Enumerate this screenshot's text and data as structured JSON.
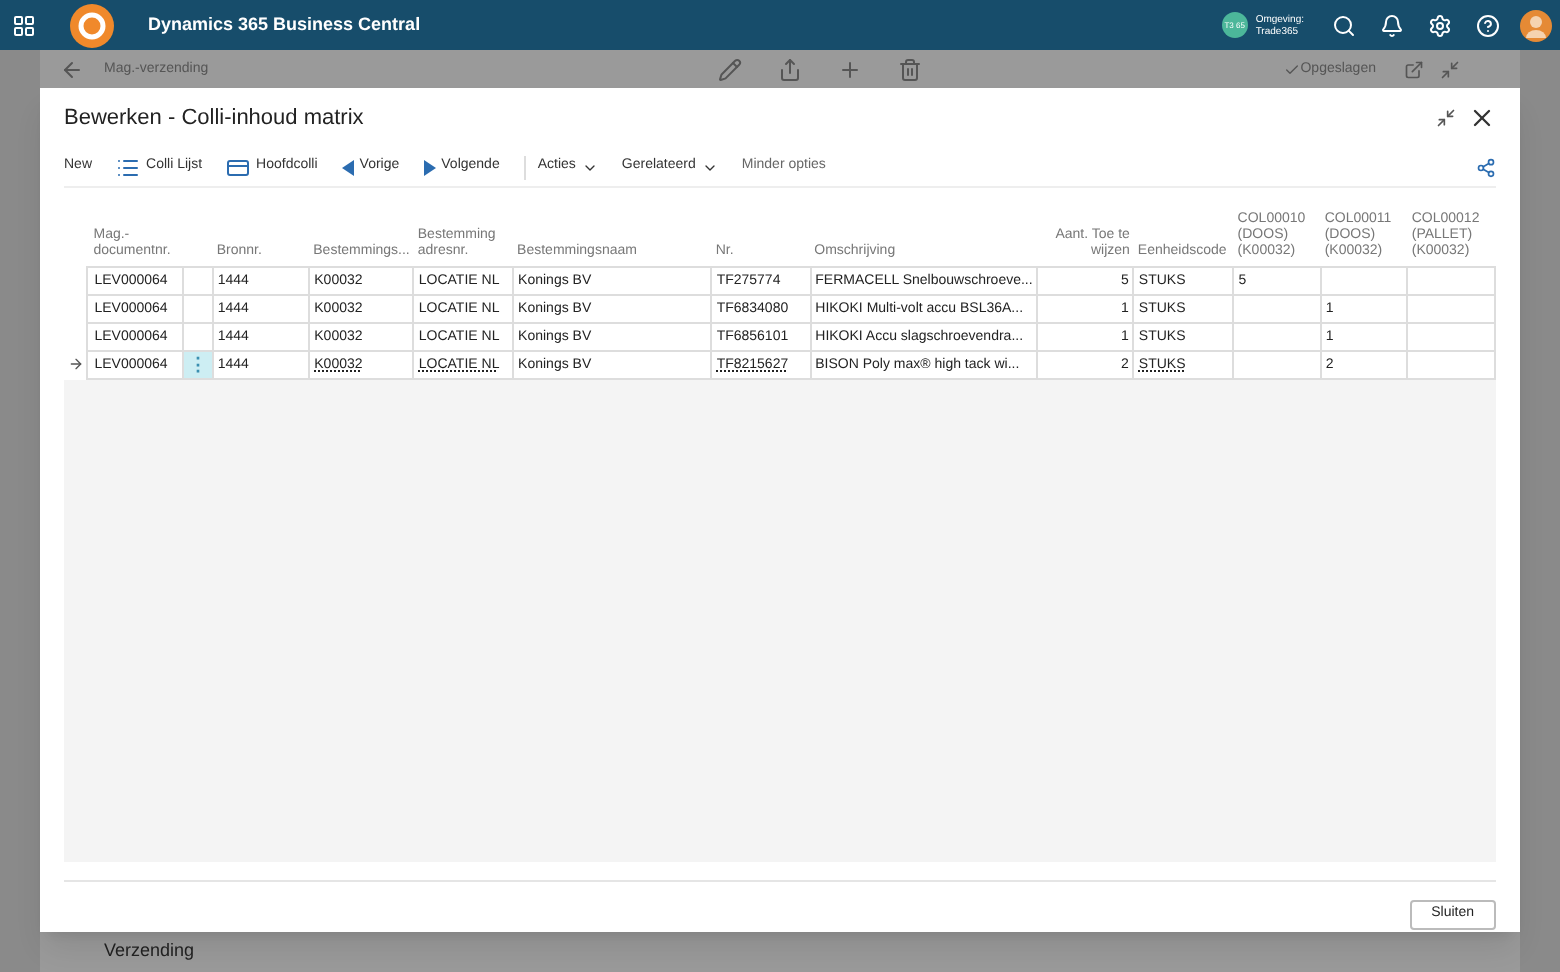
{
  "topbar": {
    "title": "Dynamics 365 Business Central",
    "env_badge": "T3 65",
    "env_label": "Omgeving:",
    "env_name": "Trade365"
  },
  "background_page": {
    "title": "Mag.-verzending",
    "status": "Opgeslagen",
    "section": "Verzending"
  },
  "dialog": {
    "title": "Bewerken - Colli-inhoud matrix",
    "actions": [
      {
        "label": "New",
        "kind": "plain"
      },
      {
        "label": "Colli Lijst",
        "kind": "list"
      },
      {
        "label": "Hoofdcolli",
        "kind": "card"
      },
      {
        "label": "Vorige",
        "kind": "prev"
      },
      {
        "label": "Volgende",
        "kind": "next"
      },
      {
        "label": "Acties",
        "kind": "menu"
      },
      {
        "label": "Gerelateerd",
        "kind": "menu"
      },
      {
        "label": "Minder opties",
        "kind": "plain"
      }
    ],
    "table": {
      "columns": [
        {
          "label": "Mag.-documentnr.",
          "kind": "text"
        },
        {
          "kind": "menu"
        },
        {
          "label": "Bronnr.",
          "kind": "text"
        },
        {
          "label": "Bestemmings...",
          "kind": "text"
        },
        {
          "label": "Bestemming adresnr.",
          "kind": "text"
        },
        {
          "label": "Bestemmingsnaam",
          "kind": "text"
        },
        {
          "label": "Nr.",
          "kind": "text"
        },
        {
          "label": "Omschrijving",
          "kind": "text"
        },
        {
          "label": "Aant. Toe te wijzen",
          "kind": "number"
        },
        {
          "label": "Eenheidscode",
          "kind": "text"
        },
        {
          "label": "COL00010 (DOOS) (K00032)",
          "kind": "text"
        },
        {
          "label": "COL00011 (DOOS) (K00032)",
          "kind": "text"
        },
        {
          "label": "COL00012 (PALLET) (K00032)",
          "kind": "text"
        }
      ],
      "rows": [
        {
          "selected": false,
          "cells": [
            "LEV000064",
            null,
            "1444",
            "K00032",
            "LOCATIE NL",
            "Konings BV",
            "TF275774",
            "FERMACELL Snelbouwschroeve...",
            "5",
            "STUKS",
            "5",
            null,
            null
          ]
        },
        {
          "selected": false,
          "cells": [
            "LEV000064",
            null,
            "1444",
            "K00032",
            "LOCATIE NL",
            "Konings BV",
            "TF6834080",
            "HIKOKI Multi-volt accu BSL36A...",
            "1",
            "STUKS",
            null,
            "1",
            null
          ]
        },
        {
          "selected": false,
          "cells": [
            "LEV000064",
            null,
            "1444",
            "K00032",
            "LOCATIE NL",
            "Konings BV",
            "TF6856101",
            "HIKOKI Accu slagschroevendra...",
            "1",
            "STUKS",
            null,
            "1",
            null
          ]
        },
        {
          "selected": true,
          "cells": [
            "LEV000064",
            "⋮",
            "1444",
            "K00032",
            "LOCATIE NL",
            "Konings BV",
            "TF8215627",
            "BISON Poly max® high tack wi...",
            "2",
            "STUKS",
            null,
            "2",
            null
          ]
        }
      ]
    },
    "close_button": "Sluiten"
  }
}
